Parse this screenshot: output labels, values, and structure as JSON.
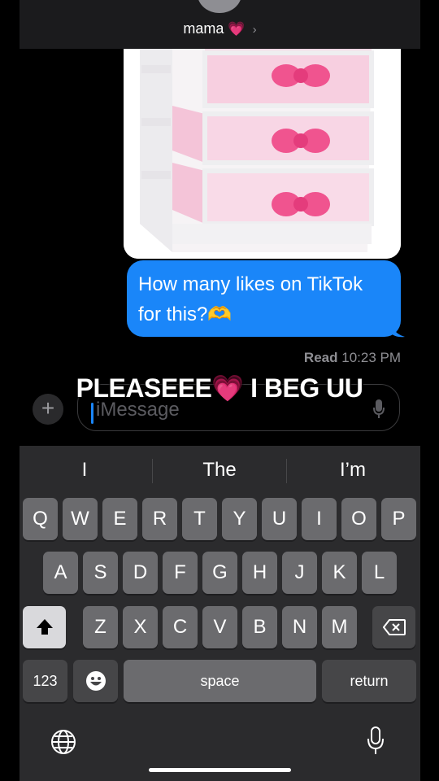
{
  "header": {
    "contact_name": "mama",
    "heart": "💗",
    "chevron": "›"
  },
  "message": {
    "text": "How many likes on TikTok for this?🫶"
  },
  "receipt": {
    "status": "Read",
    "time": "10:23 PM"
  },
  "input": {
    "placeholder": "iMessage",
    "plus": "+"
  },
  "overlay_caption": {
    "text": "PLEASEEE",
    "heart": "💗",
    "text2": " I BEG UU"
  },
  "suggestions": [
    "I",
    "The",
    "I’m"
  ],
  "keyboard": {
    "row1": [
      "Q",
      "W",
      "E",
      "R",
      "T",
      "Y",
      "U",
      "I",
      "O",
      "P"
    ],
    "row2": [
      "A",
      "S",
      "D",
      "F",
      "G",
      "H",
      "J",
      "K",
      "L"
    ],
    "row3": [
      "Z",
      "X",
      "C",
      "V",
      "B",
      "N",
      "M"
    ],
    "numbers_key": "123",
    "space_key": "space",
    "return_key": "return"
  },
  "colors": {
    "bubble_blue": "#1a86f9",
    "keyboard_bg": "#2b2b2d",
    "key": "#6b6b6e",
    "heart_pink": "#ff4fa0"
  }
}
